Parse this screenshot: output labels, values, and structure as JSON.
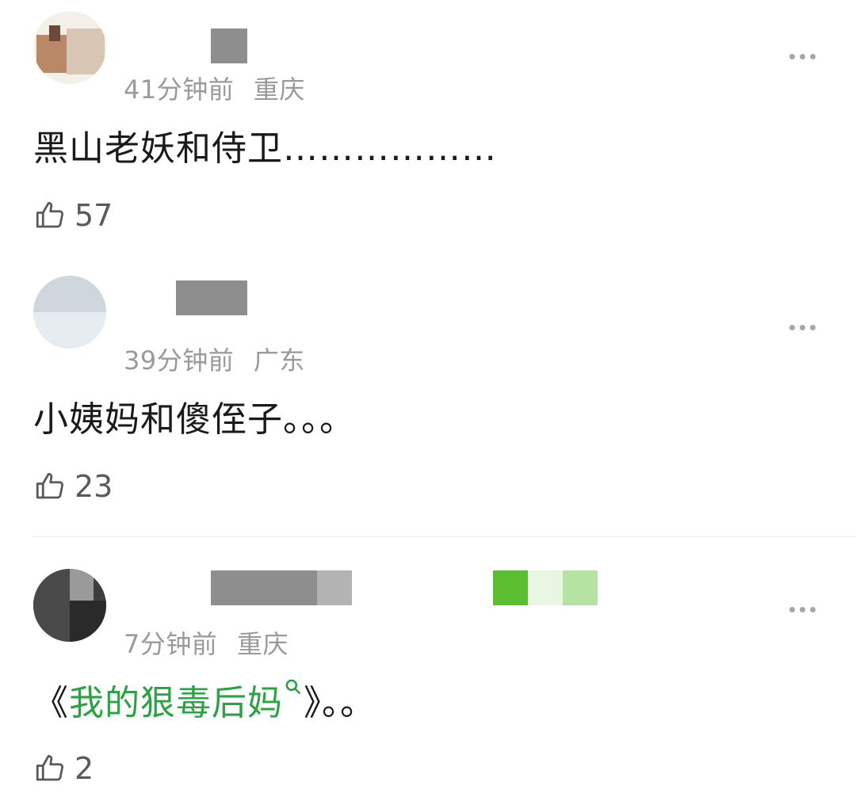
{
  "comments": [
    {
      "time": "41分钟前",
      "location": "重庆",
      "text": "黑山老妖和侍卫………………",
      "likes": "57"
    },
    {
      "time": "39分钟前",
      "location": "广东",
      "text": "小姨妈和傻侄子。。。",
      "likes": "23"
    },
    {
      "time": "7分钟前",
      "location": "重庆",
      "text_prefix": "《",
      "link_text": "我的狠毒后妈",
      "text_suffix": "》。。",
      "likes": "2"
    }
  ],
  "icons": {
    "like": "thumbs-up-icon",
    "more": "more-dots-icon",
    "search": "search-icon"
  },
  "colors": {
    "link": "#2ba244",
    "meta": "#9a9a9a"
  }
}
